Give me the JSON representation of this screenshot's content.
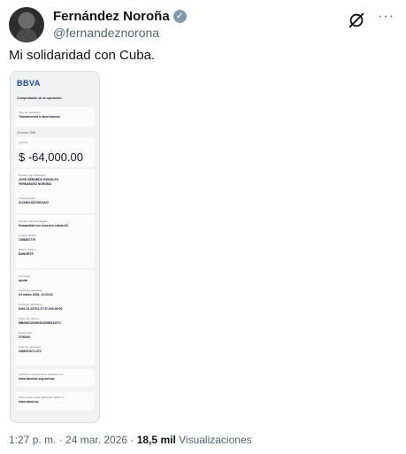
{
  "author": {
    "name": "Fernández Noroña",
    "handle": "@fernandeznorona"
  },
  "icons": {
    "verified": "verified-badge-icon",
    "grok": "grok-icon",
    "more": "more-icon"
  },
  "tweet": {
    "text": "Mi solidaridad con Cuba."
  },
  "receipt": {
    "brand": "BBVA",
    "brand_color": "#1a4ca3",
    "title": "Comprobante de la operación",
    "operation_type_label": "Tipo de operación",
    "operation_type": "Transferencia a otros bancos",
    "date": "24 marzo 2026",
    "amount_label": "Importe",
    "amount": "$ -64,000.00",
    "ordering_name_label": "Nombre del ordenante",
    "ordering_name_1": "JOSE GERARDO RODOLFO",
    "ordering_name_2": "FERNANDEZ NOROÑA",
    "origin_account_label": "Cuenta origen",
    "origin_account": "012180015276031322",
    "beneficiary_label": "Nombre del beneficiario",
    "beneficiary": "Humanidad con America Latina AC",
    "dest_account_label": "Cuenta destino",
    "dest_account": "1356451779",
    "dest_bank_label": "Banco destino",
    "dest_bank": "BANORTE",
    "concept_label": "Concepto",
    "concept": "ayuda",
    "op_date_label": "Fecha de operación",
    "op_date": "24 marzo 2026, 13:24:24",
    "apply_date_label": "Fecha de aplicación",
    "apply_date": "6401-01-03T01:37:37.000-00:00",
    "tracking_label": "Clave de rastreo",
    "tracking": "MBAN01002603240085231071",
    "reference_label": "Referencia",
    "reference": "2700240",
    "folio_label": "Folio de operación",
    "folio": "0085231071-072",
    "verify_label": "Verifica el estatus de tu operación en",
    "verify_url": "www.banxico.org.mx/cep",
    "info_label": "Información sobre aplicación SPEI en",
    "info_url": "www.bbva.mx"
  },
  "meta": {
    "time": "1:27 p. m. · 24 mar. 2026 ·",
    "views": "18,5 mil",
    "views_label": "Visualizaciones"
  }
}
